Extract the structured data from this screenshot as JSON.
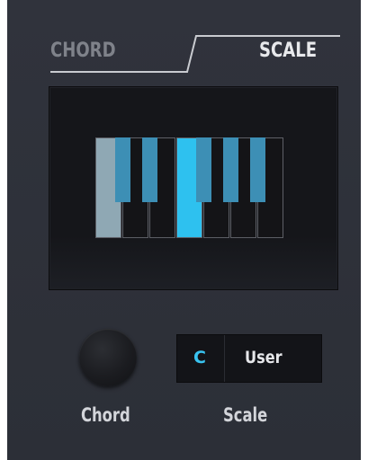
{
  "tabs": {
    "chord_label": "CHORD",
    "scale_label": "SCALE",
    "active": "SCALE"
  },
  "display": {
    "keyboard": {
      "white_keys": [
        {
          "note": "C",
          "state": "root"
        },
        {
          "note": "D",
          "state": "off"
        },
        {
          "note": "E",
          "state": "off"
        },
        {
          "note": "F",
          "state": "selected"
        },
        {
          "note": "G",
          "state": "off"
        },
        {
          "note": "A",
          "state": "off"
        },
        {
          "note": "B",
          "state": "off"
        }
      ],
      "black_keys": [
        {
          "note": "C#",
          "state": "in-scale"
        },
        {
          "note": "D#",
          "state": "in-scale"
        },
        {
          "note": "F#",
          "state": "in-scale"
        },
        {
          "note": "G#",
          "state": "in-scale"
        },
        {
          "note": "A#",
          "state": "in-scale"
        }
      ]
    }
  },
  "controls": {
    "chord_label": "Chord",
    "scale_label": "Scale",
    "root_note": "C",
    "scale_type": "User"
  },
  "colors": {
    "background": "#2e3139",
    "accent": "#39c3f0",
    "root_key": "#8fa8b4",
    "in_scale_key": "#3d8fb5",
    "selected_key": "#2ec1ef"
  }
}
